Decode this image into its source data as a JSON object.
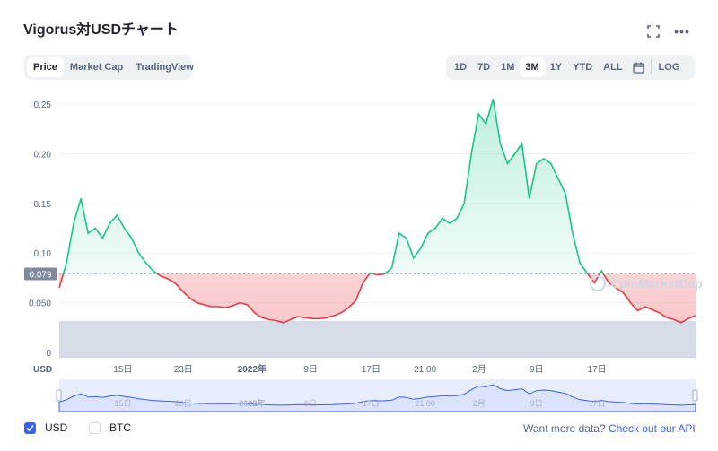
{
  "header": {
    "title": "Vigorus対USDチャート",
    "fullscreen_icon": "fullscreen-icon",
    "more_icon": "more-horizontal-icon",
    "more_glyph": "•••"
  },
  "view_tabs": [
    {
      "label": "Price",
      "active": true
    },
    {
      "label": "Market Cap",
      "active": false
    },
    {
      "label": "TradingView",
      "active": false
    }
  ],
  "range_tabs": [
    {
      "label": "1D",
      "active": false
    },
    {
      "label": "7D",
      "active": false
    },
    {
      "label": "1M",
      "active": false
    },
    {
      "label": "3M",
      "active": true
    },
    {
      "label": "1Y",
      "active": false
    },
    {
      "label": "YTD",
      "active": false
    },
    {
      "label": "ALL",
      "active": false
    }
  ],
  "calendar_icon": "calendar-icon",
  "log_label": "LOG",
  "footer": {
    "usd_label": "USD",
    "usd_checked": true,
    "btc_label": "BTC",
    "btc_checked": false,
    "api_prefix": "Want more data?",
    "api_link": "Check out our API"
  },
  "watermark": "CoinMarketCap",
  "colors": {
    "up": "#16c784",
    "down": "#ea3943",
    "accent": "#3861fb",
    "volume": "#cfd6e4"
  },
  "chart_data": {
    "type": "line",
    "currency_label": "USD",
    "reference_price": 0.079,
    "reference_label": "0.079",
    "ylim": [
      0,
      0.26
    ],
    "y_ticks": [
      0,
      0.05,
      0.1,
      0.15,
      0.2,
      0.25
    ],
    "y_tick_labels": [
      "0",
      "0.050",
      "0.10",
      "0.15",
      "0.20",
      "0.25"
    ],
    "x_ticks": [
      {
        "label": "15日",
        "at": 0.1
      },
      {
        "label": "23日",
        "at": 0.195
      },
      {
        "label": "2022年",
        "at": 0.303,
        "bold": true
      },
      {
        "label": "9日",
        "at": 0.395
      },
      {
        "label": "17日",
        "at": 0.49
      },
      {
        "label": "21:00",
        "at": 0.575
      },
      {
        "label": "2月",
        "at": 0.66
      },
      {
        "label": "9日",
        "at": 0.75
      },
      {
        "label": "17日",
        "at": 0.845
      }
    ],
    "grid": true,
    "series": [
      {
        "values": [
          0.065,
          0.09,
          0.13,
          0.155,
          0.12,
          0.125,
          0.115,
          0.13,
          0.138,
          0.125,
          0.115,
          0.1,
          0.09,
          0.082,
          0.077,
          0.074,
          0.07,
          0.062,
          0.055,
          0.05,
          0.048,
          0.046,
          0.046,
          0.045,
          0.047,
          0.05,
          0.048,
          0.04,
          0.035,
          0.033,
          0.032,
          0.03,
          0.033,
          0.036,
          0.035,
          0.034,
          0.034,
          0.035,
          0.037,
          0.04,
          0.045,
          0.052,
          0.07,
          0.08,
          0.078,
          0.079,
          0.085,
          0.12,
          0.115,
          0.095,
          0.105,
          0.12,
          0.125,
          0.135,
          0.13,
          0.135,
          0.15,
          0.2,
          0.24,
          0.23,
          0.255,
          0.21,
          0.19,
          0.2,
          0.21,
          0.155,
          0.19,
          0.195,
          0.19,
          0.175,
          0.16,
          0.12,
          0.09,
          0.08,
          0.07,
          0.082,
          0.07,
          0.065,
          0.06,
          0.05,
          0.042,
          0.046,
          0.043,
          0.04,
          0.035,
          0.033,
          0.03,
          0.034,
          0.037
        ],
        "volume": [
          1,
          1,
          1,
          1,
          1,
          1,
          1,
          1,
          1,
          1,
          1,
          1,
          1,
          1,
          1,
          1,
          1,
          1,
          1,
          1,
          1,
          1,
          1,
          1,
          1,
          1,
          1,
          1,
          1,
          1,
          1,
          1,
          1,
          1,
          1,
          1,
          1,
          1,
          1,
          1,
          1,
          1,
          1,
          1,
          1,
          1,
          1,
          1,
          1,
          1,
          1,
          1,
          1,
          1,
          1,
          1,
          1,
          1,
          1,
          1,
          1,
          1,
          1,
          1,
          1,
          1,
          1,
          1,
          1,
          1,
          1,
          1,
          1,
          1,
          1,
          1,
          1,
          1,
          1,
          1,
          1,
          1,
          1,
          1,
          1,
          1,
          1,
          1,
          1
        ]
      }
    ],
    "navigator": {
      "start": 0,
      "end": 1
    }
  }
}
